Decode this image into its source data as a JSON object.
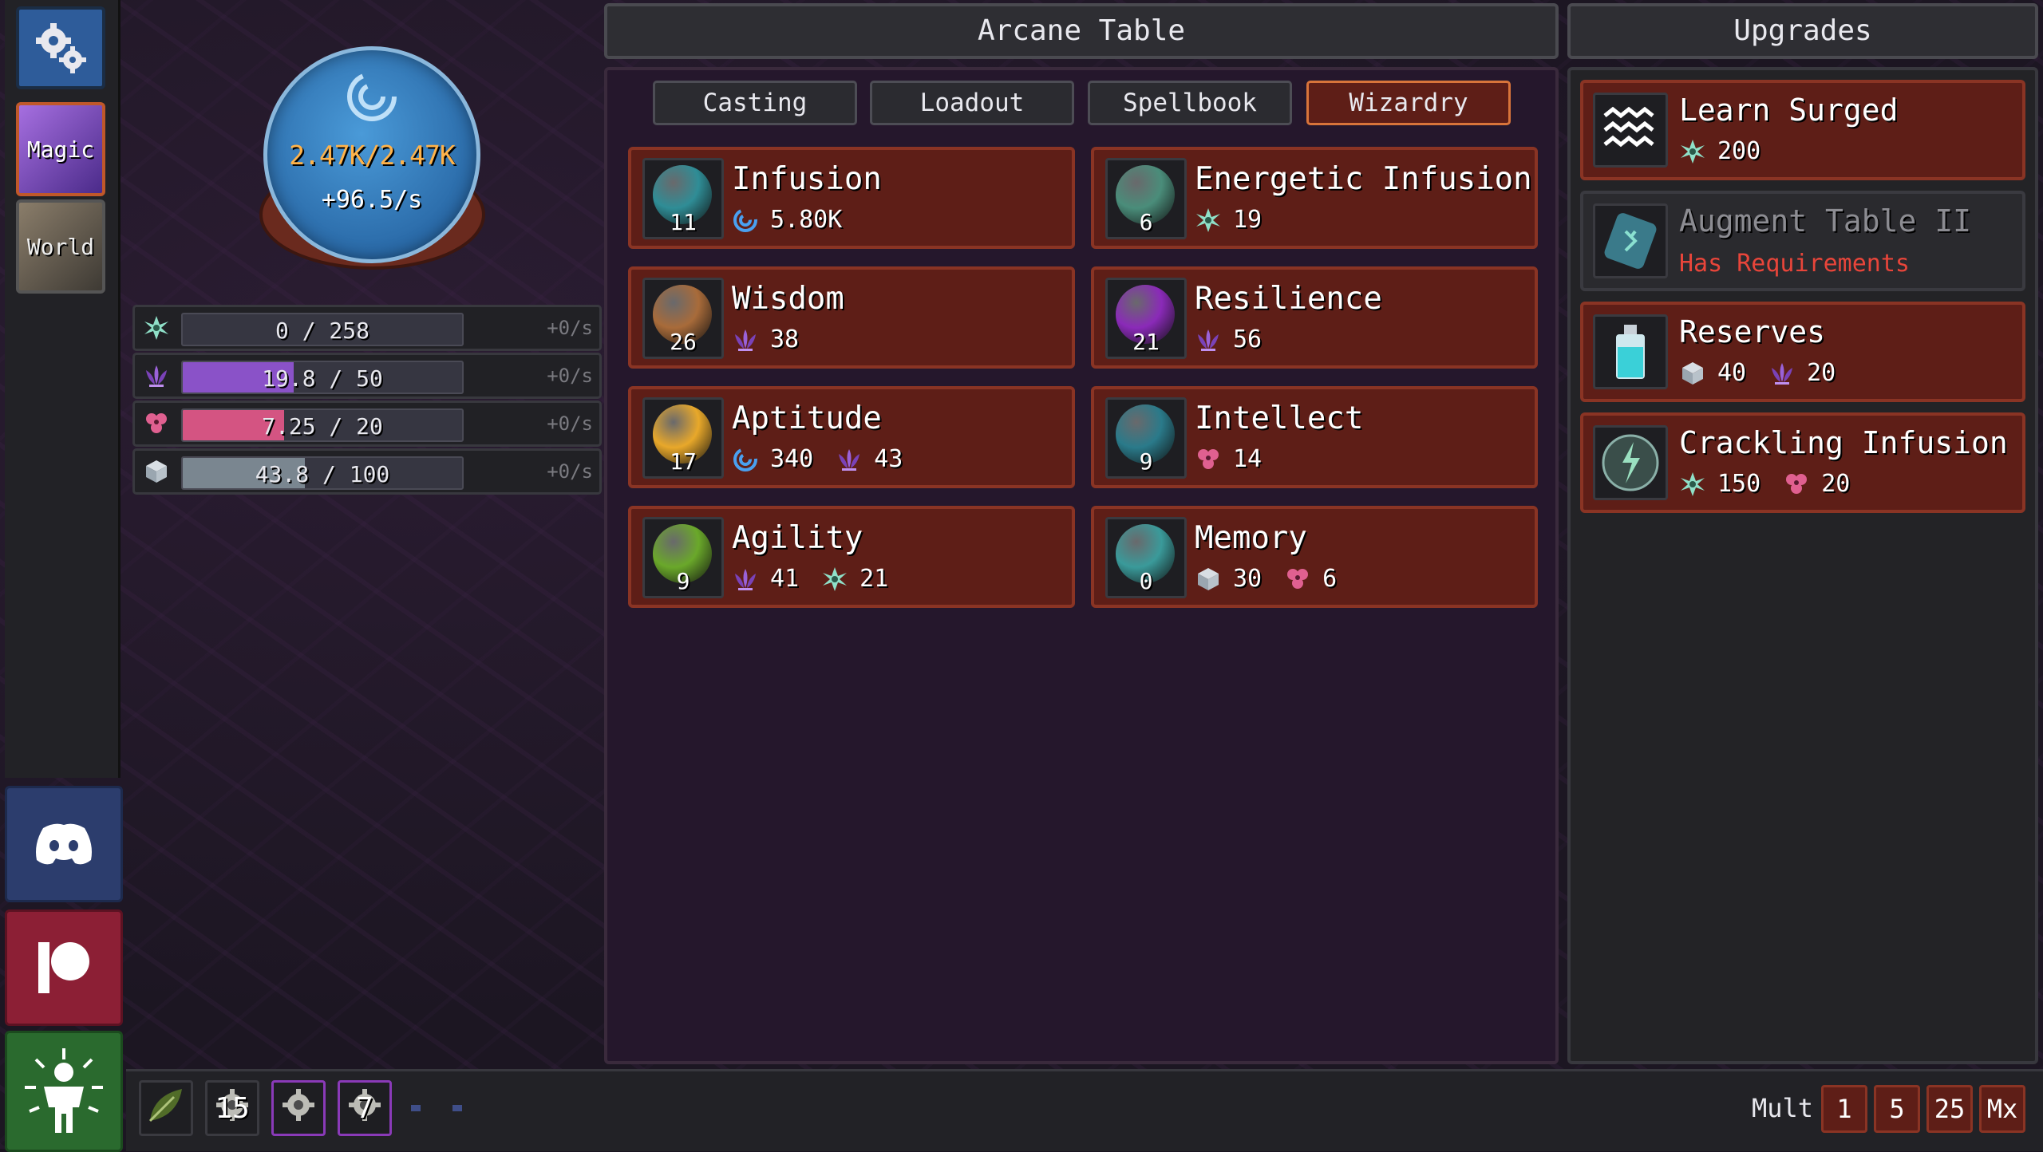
{
  "nav": {
    "magic_label": "Magic",
    "world_label": "World"
  },
  "mana": {
    "value": "2.47K/2.47K",
    "rate": "+96.5/s"
  },
  "resources": [
    {
      "icon": "spark-icon",
      "text": "0 / 258",
      "rate": "+0/s",
      "fill": 0.0,
      "color": "#46465a"
    },
    {
      "icon": "lotus-icon",
      "text": "19.8 / 50",
      "rate": "+0/s",
      "fill": 0.396,
      "color": "#8a52c8"
    },
    {
      "icon": "triheart-icon",
      "text": "7.25 / 20",
      "rate": "+0/s",
      "fill": 0.3625,
      "color": "#d45482"
    },
    {
      "icon": "cube-icon",
      "text": "43.8 / 100",
      "rate": "+0/s",
      "fill": 0.438,
      "color": "#7a8690"
    }
  ],
  "panel": {
    "title": "Arcane Table",
    "tabs": [
      "Casting",
      "Loadout",
      "Spellbook",
      "Wizardry"
    ],
    "active_tab": "Wizardry"
  },
  "cards": [
    {
      "name": "Infusion",
      "level": "11",
      "orb": "#2f8d96",
      "costs": [
        {
          "icon": "swirl-icon",
          "value": "5.80K"
        }
      ]
    },
    {
      "name": "Energetic Infusion",
      "level": "6",
      "orb": "#4a8d7a",
      "costs": [
        {
          "icon": "spark-icon",
          "value": "19"
        }
      ]
    },
    {
      "name": "Wisdom",
      "level": "26",
      "orb": "#a86b3a",
      "costs": [
        {
          "icon": "lotus-icon",
          "value": "38"
        }
      ]
    },
    {
      "name": "Resilience",
      "level": "21",
      "orb": "#8a2ab8",
      "costs": [
        {
          "icon": "lotus-icon",
          "value": "56"
        }
      ]
    },
    {
      "name": "Aptitude",
      "level": "17",
      "orb": "#e8a82a",
      "costs": [
        {
          "icon": "swirl-icon",
          "value": "340"
        },
        {
          "icon": "lotus-icon",
          "value": "43"
        }
      ]
    },
    {
      "name": "Intellect",
      "level": "9",
      "orb": "#2a7a8a",
      "costs": [
        {
          "icon": "triheart-icon",
          "value": "14"
        }
      ]
    },
    {
      "name": "Agility",
      "level": "9",
      "orb": "#6aa82a",
      "costs": [
        {
          "icon": "lotus-icon",
          "value": "41"
        },
        {
          "icon": "spark-icon",
          "value": "21"
        }
      ]
    },
    {
      "name": "Memory",
      "level": "0",
      "orb": "#3a9a9a",
      "costs": [
        {
          "icon": "cube-icon",
          "value": "30"
        },
        {
          "icon": "triheart-icon",
          "value": "6"
        }
      ]
    }
  ],
  "upgrades": {
    "title": "Upgrades",
    "items": [
      {
        "name": "Learn Surged",
        "icon": "waves-icon",
        "locked": false,
        "costs": [
          {
            "icon": "spark-icon",
            "value": "200"
          }
        ]
      },
      {
        "name": "Augment Table II",
        "icon": "rune-stone-icon",
        "locked": true,
        "requirement": "Has Requirements"
      },
      {
        "name": "Reserves",
        "icon": "potion-icon",
        "locked": false,
        "costs": [
          {
            "icon": "cube-icon",
            "value": "40"
          },
          {
            "icon": "lotus-icon",
            "value": "20"
          }
        ]
      },
      {
        "name": "Crackling Infusion",
        "icon": "lightning-orb-icon",
        "locked": false,
        "costs": [
          {
            "icon": "spark-icon",
            "value": "150"
          },
          {
            "icon": "triheart-icon",
            "value": "20"
          }
        ]
      }
    ]
  },
  "quickslots": [
    {
      "icon": "leaf-icon",
      "count": ""
    },
    {
      "icon": "gear-charm-icon",
      "count": "15"
    },
    {
      "icon": "gear-charm-icon",
      "count": ""
    },
    {
      "icon": "gear-charm-icon",
      "count": "7"
    }
  ],
  "mult": {
    "label": "Mult",
    "options": [
      "1",
      "5",
      "25",
      "Mx"
    ]
  }
}
